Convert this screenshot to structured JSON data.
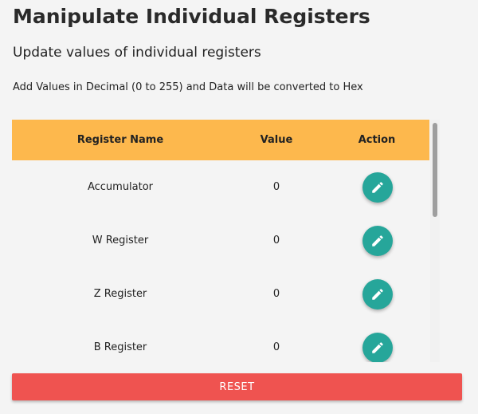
{
  "page": {
    "title": "Manipulate Individual Registers",
    "subtitle": "Update values of individual registers",
    "hint": "Add Values in Decimal (0 to 255) and Data will be converted to Hex"
  },
  "table": {
    "header": {
      "name": "Register Name",
      "value": "Value",
      "action": "Action"
    },
    "header_color": "#fdb84d",
    "rows": [
      {
        "name": "Accumulator",
        "value": "0"
      },
      {
        "name": "W Register",
        "value": "0"
      },
      {
        "name": "Z Register",
        "value": "0"
      },
      {
        "name": "B Register",
        "value": "0"
      }
    ],
    "action_icon": "pencil-icon",
    "action_color": "#26a69a"
  },
  "reset": {
    "label": "RESET",
    "color": "#ef5350"
  }
}
